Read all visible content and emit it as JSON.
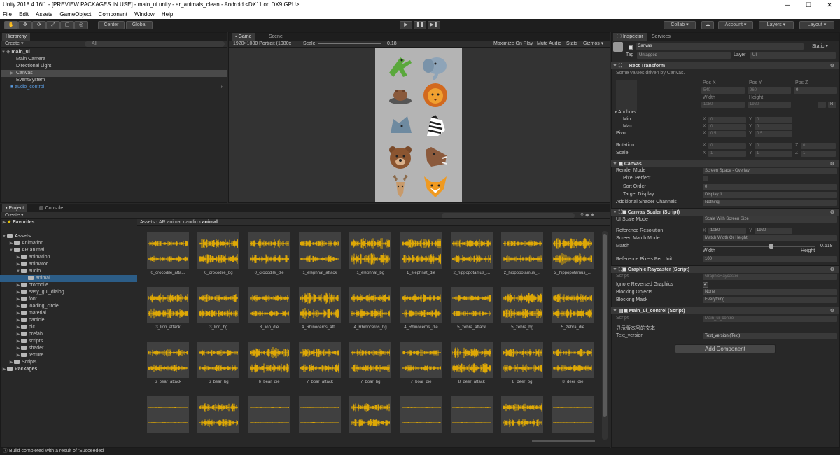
{
  "window": {
    "title": "Unity 2018.4.16f1 - [PREVIEW PACKAGES IN USE] - main_ui.unity - ar_animals_clean - Android <DX11 on DX9 GPU>",
    "minimize": "─",
    "maximize": "☐",
    "close": "✕"
  },
  "menu": [
    "File",
    "Edit",
    "Assets",
    "GameObject",
    "Component",
    "Window",
    "Help"
  ],
  "toolbar": {
    "pivot": "Center",
    "space": "Global",
    "collab": "Collab ▾",
    "account": "Account ▾",
    "layers": "Layers ▾",
    "layout": "Layout ▾"
  },
  "hierarchy": {
    "tab": "Hierarchy",
    "create": "Create ▾",
    "search": "All",
    "scene": "main_ui",
    "items": [
      "Main Camera",
      "Directional Light",
      "Canvas",
      "EventSystem",
      "audio_control"
    ]
  },
  "game": {
    "tabs": [
      "Game",
      "Scene"
    ],
    "resolution": "1920×1080 Portrait (1080x",
    "scale_label": "Scale",
    "scale_value": "0.18",
    "toggles": [
      "Maximize On Play",
      "Mute Audio",
      "Stats",
      "Gizmos ▾"
    ]
  },
  "project": {
    "tabs": [
      "Project",
      "Console"
    ],
    "create": "Create ▾",
    "breadcrumb": [
      "Assets",
      "AR animal",
      "audio",
      "animal"
    ],
    "tree": [
      {
        "label": "Favorites",
        "indent": 0,
        "bold": true
      },
      {
        "label": "Assets",
        "indent": 0,
        "bold": true
      },
      {
        "label": "Animation",
        "indent": 1
      },
      {
        "label": "AR animal",
        "indent": 1
      },
      {
        "label": "animation",
        "indent": 2
      },
      {
        "label": "animator",
        "indent": 2
      },
      {
        "label": "audio",
        "indent": 2
      },
      {
        "label": "animal",
        "indent": 3,
        "selected": true
      },
      {
        "label": "crocodile",
        "indent": 2
      },
      {
        "label": "easy_gui_dialog",
        "indent": 2
      },
      {
        "label": "font",
        "indent": 2
      },
      {
        "label": "loading_circle",
        "indent": 2
      },
      {
        "label": "material",
        "indent": 2
      },
      {
        "label": "particle",
        "indent": 2
      },
      {
        "label": "pic",
        "indent": 2
      },
      {
        "label": "prefab",
        "indent": 2
      },
      {
        "label": "scripts",
        "indent": 2
      },
      {
        "label": "shader",
        "indent": 2
      },
      {
        "label": "texture",
        "indent": 2
      },
      {
        "label": "Scripts",
        "indent": 1
      },
      {
        "label": "Packages",
        "indent": 0,
        "bold": true
      }
    ],
    "assets": [
      "0_crocodile_atta...",
      "0_crocodile_bg",
      "0_crocodile_die",
      "1_elephnat_attack",
      "1_elephnat_bg",
      "1_elephnat_die",
      "2_hippopotamus_...",
      "2_hippopotamus_...",
      "2_hippopotamus_...",
      "3_lion_attack",
      "3_lion_bg",
      "3_lion_die",
      "4_Rhinoceros_att...",
      "4_Rhinoceros_bg",
      "4_Rhinoceros_die",
      "5_zebra_attack",
      "5_zebra_bg",
      "5_zebra_die",
      "6_bear_attack",
      "6_bear_bg",
      "6_bear_die",
      "7_boar_attack",
      "7_boar_bg",
      "7_boar_die",
      "8_deer_attack",
      "8_deer_bg",
      "8_deer_die",
      "",
      "",
      "",
      "",
      "",
      "",
      "",
      "",
      ""
    ]
  },
  "status": "Build completed with a result of 'Succeeded'",
  "inspector": {
    "tabs": [
      "Inspector",
      "Services"
    ],
    "object": "Canvas",
    "static": "Static ▾",
    "tag_label": "Tag",
    "tag": "Untagged",
    "layer_label": "Layer",
    "layer": "UI",
    "rect": {
      "title": "Rect Transform",
      "note": "Some values driven by Canvas.",
      "pos_labels": [
        "Pos X",
        "Pos Y",
        "Pos Z"
      ],
      "pos": [
        "540",
        "960",
        "0"
      ],
      "size_labels": [
        "Width",
        "Height"
      ],
      "size": [
        "1080",
        "1920"
      ],
      "r_btn": "R",
      "anchors": "Anchors",
      "min": "Min",
      "max": "Max",
      "pivot": "Pivot",
      "rotation": "Rotation",
      "scale": "Scale",
      "min_x": "0",
      "min_y": "0",
      "max_x": "0",
      "max_y": "0",
      "pivot_x": "0.5",
      "pivot_y": "0.5",
      "rot_x": "0",
      "rot_y": "0",
      "rot_z": "0",
      "scale_x": "1",
      "scale_y": "1",
      "scale_z": "1",
      "x": "X",
      "y": "Y",
      "z": "Z"
    },
    "canvas": {
      "title": "Canvas",
      "render_mode_label": "Render Mode",
      "render_mode": "Screen Space - Overlay",
      "pixel_perfect": "Pixel Perfect",
      "sort_order_label": "Sort Order",
      "sort_order": "0",
      "target_display_label": "Target Display",
      "target_display": "Display 1",
      "shader_label": "Additional Shader Channels",
      "shader": "Nothing"
    },
    "scaler": {
      "title": "Canvas Scaler (Script)",
      "ui_scale_label": "UI Scale Mode",
      "ui_scale": "Scale With Screen Size",
      "ref_res_label": "Reference Resolution",
      "ref_x": "1080",
      "ref_y": "1920",
      "match_mode_label": "Screen Match Mode",
      "match_mode": "Match Width Or Height",
      "match_label": "Match",
      "match_value": "0.618",
      "match_fraction": 0.618,
      "width": "Width",
      "height": "Height",
      "ppu_label": "Reference Pixels Per Unit",
      "ppu": "100"
    },
    "raycaster": {
      "title": "Graphic Raycaster (Script)",
      "script_label": "Script",
      "script": "GraphicRaycaster",
      "ignore_label": "Ignore Reversed Graphics",
      "blocking_objects_label": "Blocking Objects",
      "blocking_objects": "None",
      "blocking_mask_label": "Blocking Mask",
      "blocking_mask": "Everything"
    },
    "control": {
      "title": "Main_ui_control (Script)",
      "script_label": "Script",
      "script": "Main_ui_control",
      "cn_label": "显示版本号的文本",
      "text_version_label": "Text_version",
      "text_version": "Text_version (Text)"
    },
    "add_component": "Add Component"
  },
  "colors": {
    "wave": "#f0b400",
    "game_bg": "#b4b4b4",
    "accent": "#2c5d87"
  }
}
